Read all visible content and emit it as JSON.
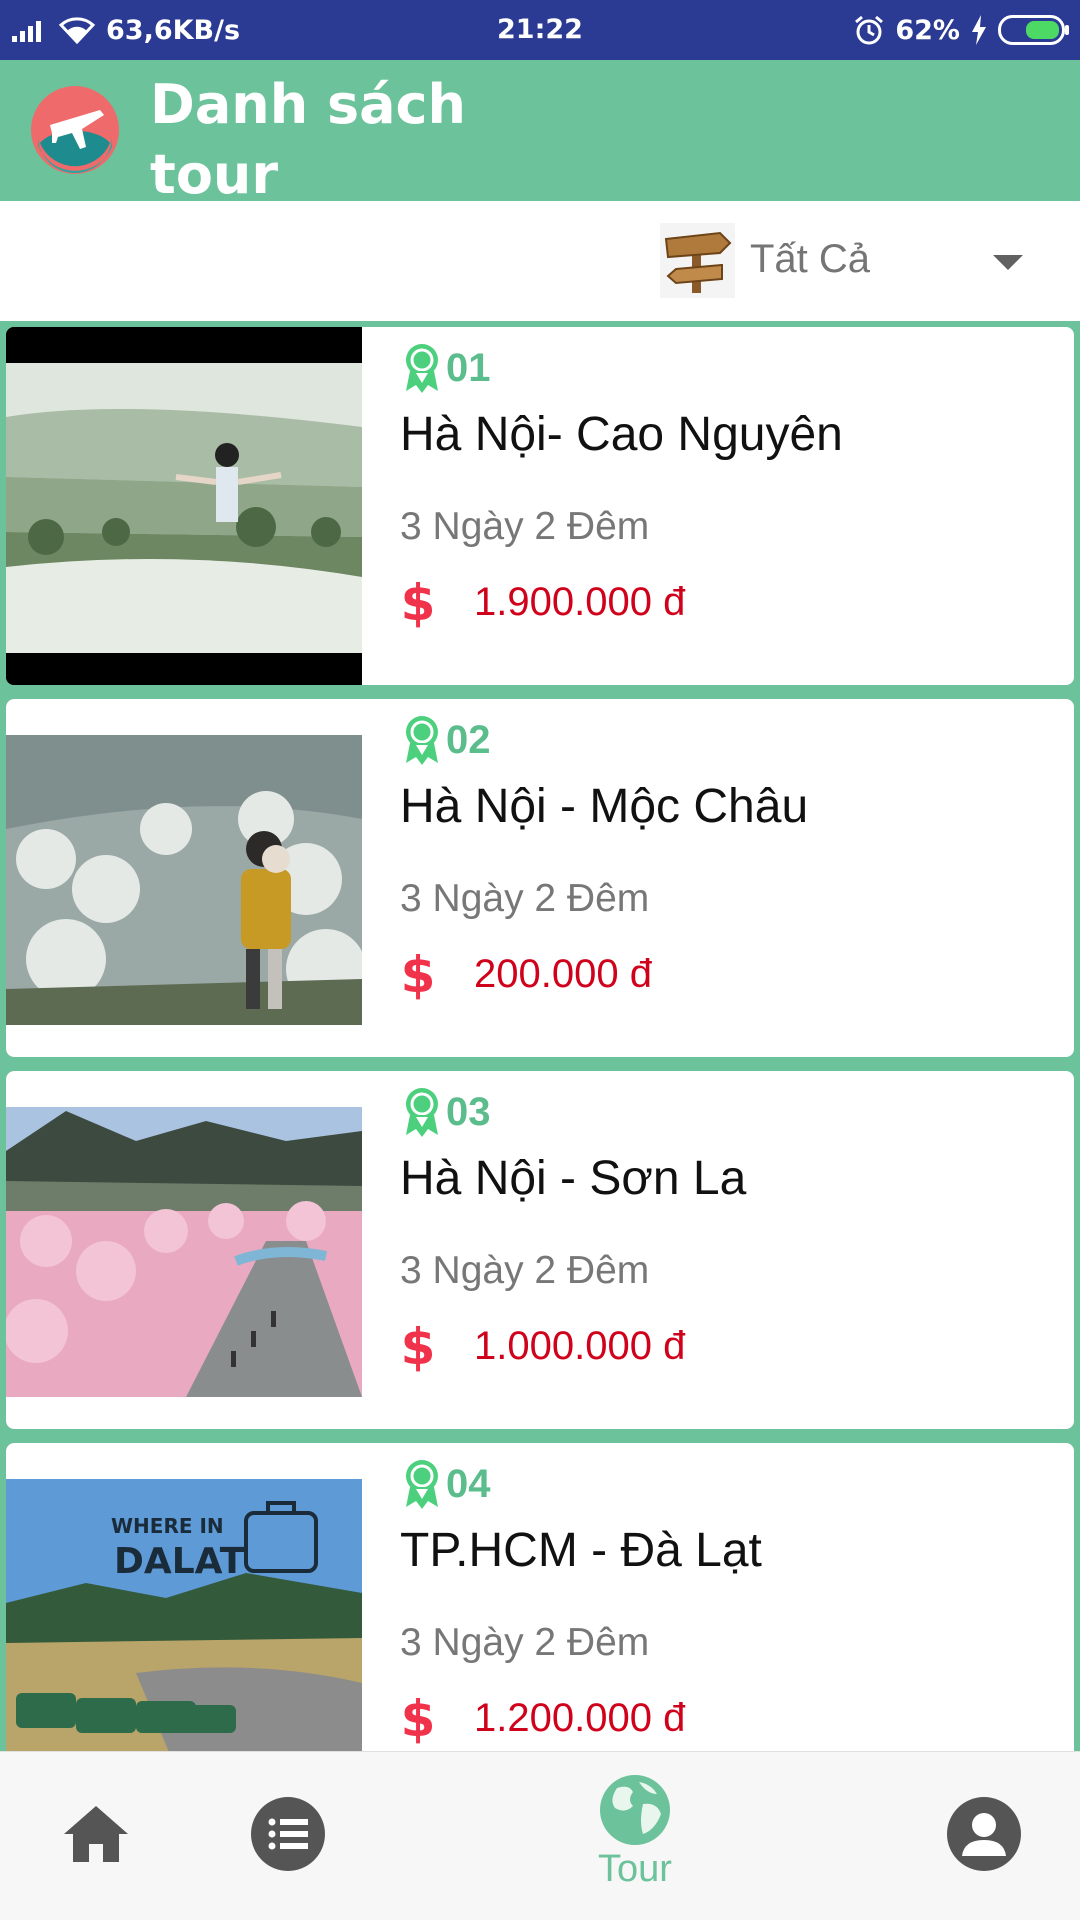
{
  "status_bar": {
    "network_speed": "63,6KB/s",
    "time": "21:22",
    "battery": "62%",
    "icons": [
      "signal-icon",
      "wifi-icon",
      "alarm-icon",
      "charging-icon",
      "battery-icon"
    ]
  },
  "app_bar": {
    "title": "Danh sách tour",
    "logo_icon": "airplane-globe-logo"
  },
  "filter": {
    "icon": "signpost-icon",
    "selected": "Tất Cả"
  },
  "tours": [
    {
      "number": "01",
      "name": "Hà Nội- Cao Nguyên",
      "duration": "3 Ngày 2 Đêm",
      "price": "1.900.000 đ"
    },
    {
      "number": "02",
      "name": "Hà Nội - Mộc Châu",
      "duration": "3 Ngày 2 Đêm",
      "price": "200.000 đ"
    },
    {
      "number": "03",
      "name": "Hà Nội - Sơn La",
      "duration": "3 Ngày 2 Đêm",
      "price": "1.000.000 đ"
    },
    {
      "number": "04",
      "name": "TP.HCM - Đà Lạt",
      "duration": "3 Ngày 2 Đêm",
      "price": "1.200.000 đ"
    }
  ],
  "bottom_nav": {
    "items": [
      {
        "icon": "home-icon"
      },
      {
        "icon": "list-icon"
      },
      {
        "icon": "globe-icon",
        "label": "Tour",
        "active": true
      },
      {
        "icon": "profile-icon"
      }
    ]
  },
  "colors": {
    "status_bar": "#2b3a92",
    "primary": "#6cc29a",
    "price": "#d0021b",
    "badge": "#5bbd8c"
  }
}
